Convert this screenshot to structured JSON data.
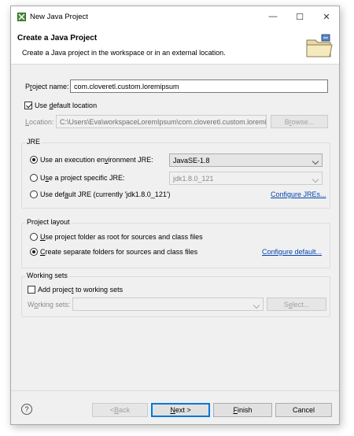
{
  "window": {
    "title": "New Java Project",
    "controls": {
      "minimize": "—",
      "maximize": "☐",
      "close": "✕"
    }
  },
  "header": {
    "title": "Create a Java Project",
    "description": "Create a Java project in the workspace or in an external location."
  },
  "project": {
    "name_label_pre": "P",
    "name_label_u": "r",
    "name_label_post": "oject name:",
    "name_value": "com.cloveretl.custom.loremipsum"
  },
  "location": {
    "use_default_pre": "Use ",
    "use_default_u": "d",
    "use_default_post": "efault location",
    "use_default_checked": true,
    "label_pre": "",
    "label_u": "L",
    "label_post": "ocation:",
    "path_value": "C:\\Users\\Eva\\workspaceLoremIpsum\\com.cloveretl.custom.loremi",
    "browse_label_pre": "B",
    "browse_label_u": "r",
    "browse_label_post": "owse..."
  },
  "jre": {
    "group_title": "JRE",
    "option_env_pre": "Use an execution en",
    "option_env_u": "v",
    "option_env_post": "ironment JRE:",
    "option_env_value": "JavaSE-1.8",
    "option_specific_pre": "U",
    "option_specific_u": "s",
    "option_specific_post": "e a project specific JRE:",
    "option_specific_value": "jdk1.8.0_121",
    "option_default_pre": "Use def",
    "option_default_u": "a",
    "option_default_post": "ult JRE (currently 'jdk1.8.0_121')",
    "configure_link": "Configure JREs...",
    "selected": "env"
  },
  "layout": {
    "group_title": "Project layout",
    "option_root_pre": "",
    "option_root_u": "U",
    "option_root_post": "se project folder as root for sources and class files",
    "option_separate_pre": "",
    "option_separate_u": "C",
    "option_separate_post": "reate separate folders for sources and class files",
    "configure_link": "Configure default...",
    "selected": "separate"
  },
  "working_sets": {
    "group_title": "Working sets",
    "add_pre": "Add projec",
    "add_u": "t",
    "add_post": " to working sets",
    "add_checked": false,
    "label_pre": "W",
    "label_u": "o",
    "label_post": "rking sets:",
    "select_label_pre": "S",
    "select_label_u": "e",
    "select_label_post": "lect..."
  },
  "footer": {
    "help": "?",
    "back_pre": "< ",
    "back_u": "B",
    "back_post": "ack",
    "next_pre": "",
    "next_u": "N",
    "next_post": "ext >",
    "finish_pre": "",
    "finish_u": "F",
    "finish_post": "inish",
    "cancel": "Cancel"
  },
  "colors": {
    "link": "#0645ad",
    "default_button_border": "#0078d7",
    "dialog_bg": "#f0f0f0"
  }
}
